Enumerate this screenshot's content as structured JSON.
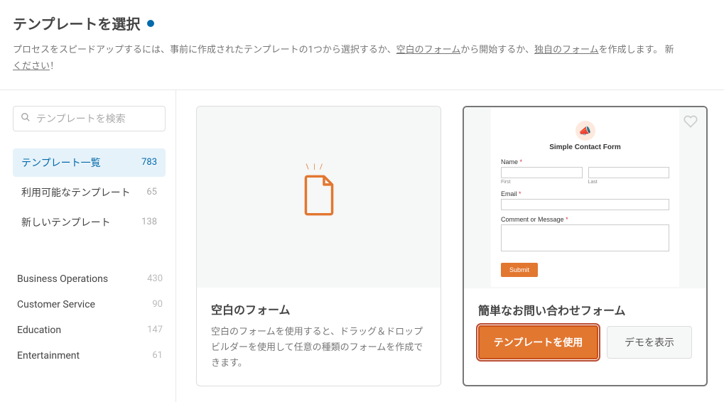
{
  "header": {
    "title": "テンプレートを選択",
    "sub_before_link1": "プロセスをスピードアップするには、事前に作成されたテンプレートの1つから選択するか、",
    "link1": "空白のフォーム",
    "sub_mid": "から開始するか、",
    "link2": "独自のフォーム",
    "sub_after_link2": "を作成します。 新",
    "link3": "ください",
    "sub_tail": "！"
  },
  "search": {
    "placeholder": "テンプレートを検索"
  },
  "nav": {
    "all": {
      "label": "テンプレート一覧",
      "count": "783"
    },
    "available": {
      "label": "利用可能なテンプレート",
      "count": "65"
    },
    "new": {
      "label": "新しいテンプレート",
      "count": "138"
    }
  },
  "categories": {
    "biz": {
      "label": "Business Operations",
      "count": "430"
    },
    "cs": {
      "label": "Customer Service",
      "count": "90"
    },
    "edu": {
      "label": "Education",
      "count": "147"
    },
    "ent": {
      "label": "Entertainment",
      "count": "61"
    }
  },
  "cards": {
    "blank": {
      "title": "空白のフォーム",
      "desc": "空白のフォームを使用すると、ドラッグ＆ドロップビルダーを使用して任意の種類のフォームを作成できます。"
    },
    "contact": {
      "title": "簡単なお問い合わせフォーム",
      "use_label": "テンプレートを使用",
      "demo_label": "デモを表示",
      "preview": {
        "title": "Simple Contact Form",
        "name_label": "Name",
        "first": "First",
        "last": "Last",
        "email_label": "Email",
        "msg_label": "Comment or Message",
        "submit": "Submit"
      }
    }
  }
}
